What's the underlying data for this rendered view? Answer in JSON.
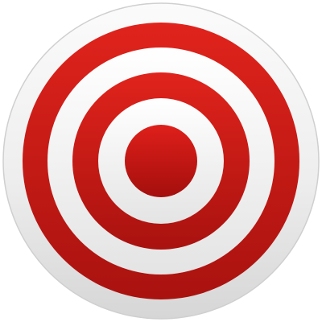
{
  "icon": {
    "name": "target-icon",
    "colors": {
      "background": "#ffffff",
      "disc_light": "#fbfbfb",
      "disc_mid": "#eeeeee",
      "disc_dark": "#d6d6d6",
      "rim": "#cfcfcf",
      "ring_light": "#e0231c",
      "ring_dark": "#a9120f",
      "gap_light": "#ffffff",
      "gap_dark": "#e4e4e4",
      "bullseye_light": "#df1f1a",
      "bullseye_dark": "#a40f0d"
    },
    "rings": [
      {
        "name": "outer-red-ring",
        "kind": "red"
      },
      {
        "name": "outer-white-ring",
        "kind": "white"
      },
      {
        "name": "middle-red-ring",
        "kind": "red"
      },
      {
        "name": "inner-white-ring",
        "kind": "white"
      },
      {
        "name": "inner-red-ring",
        "kind": "red"
      },
      {
        "name": "center-white-ring",
        "kind": "white"
      },
      {
        "name": "bullseye",
        "kind": "bull"
      }
    ]
  }
}
